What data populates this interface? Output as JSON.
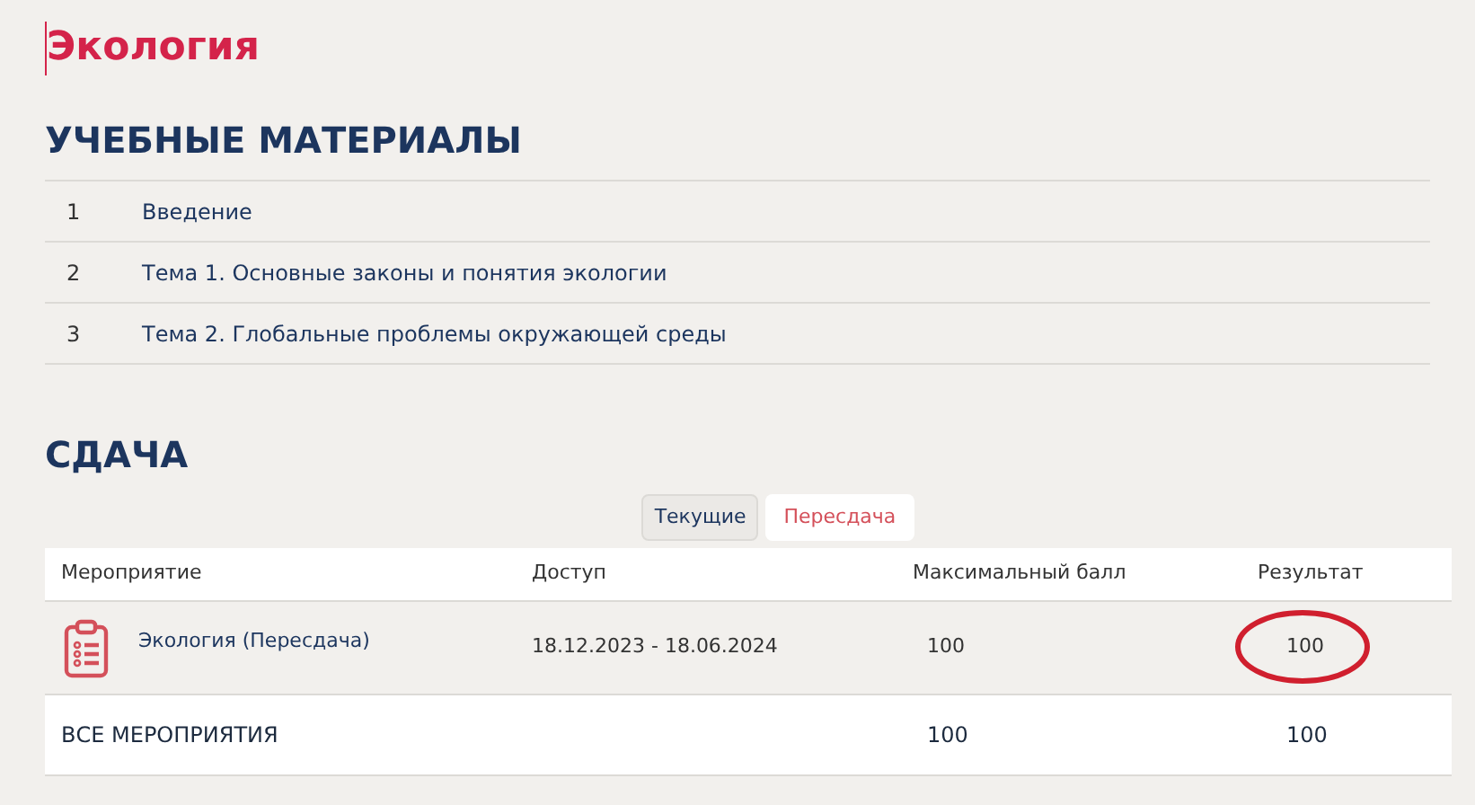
{
  "course_title": "Экология",
  "materials": {
    "heading": "УЧЕБНЫЕ МАТЕРИАЛЫ",
    "items": [
      {
        "number": "1",
        "title": "Введение"
      },
      {
        "number": "2",
        "title": "Тема 1. Основные законы и понятия экологии"
      },
      {
        "number": "3",
        "title": "Тема 2. Глобальные проблемы окружающей среды"
      }
    ]
  },
  "assessment": {
    "heading": "СДАЧА",
    "tabs": [
      {
        "label": "Текущие",
        "selected": false
      },
      {
        "label": "Пересдача",
        "selected": true
      }
    ],
    "table": {
      "columns": [
        "Мероприятие",
        "Доступ",
        "Максимальный балл",
        "Результат"
      ],
      "rows": [
        {
          "event": "Экология (Пересдача)",
          "access": "18.12.2023 - 18.06.2024",
          "max_score": "100",
          "result": "100",
          "result_circled": true
        }
      ],
      "total": {
        "label": "ВСЕ МЕРОПРИЯТИЯ",
        "max_score": "100",
        "result": "100"
      }
    }
  }
}
